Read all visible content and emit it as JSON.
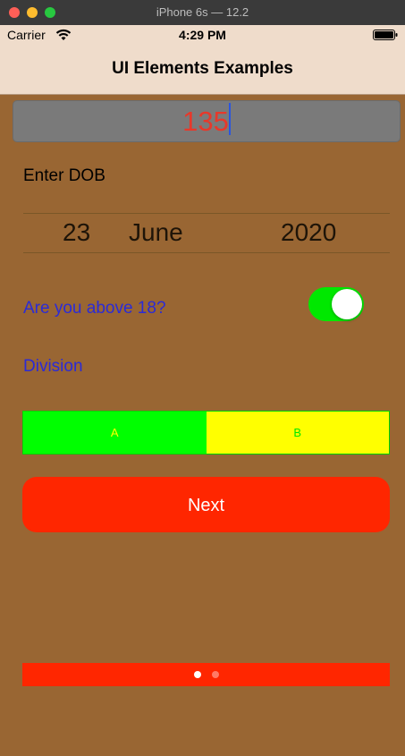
{
  "simulator": {
    "window_title": "iPhone 6s — 12.2"
  },
  "status_bar": {
    "carrier": "Carrier",
    "time": "4:29 PM",
    "wifi_icon": "wifi-icon",
    "battery_icon": "battery-icon"
  },
  "navigation": {
    "title": "UI Elements Examples"
  },
  "number_field": {
    "value": "135"
  },
  "dob": {
    "label": "Enter DOB",
    "day": "23",
    "month": "June",
    "year": "2020"
  },
  "age_toggle": {
    "label": "Are you above 18?",
    "is_on": true
  },
  "division": {
    "label": "Division",
    "segments": [
      "A",
      "B"
    ],
    "selected_index": 0
  },
  "next_button": {
    "label": "Next"
  },
  "page_control": {
    "page_count": 2,
    "current_page": 1
  },
  "colors": {
    "background": "#996633",
    "nav_background": "#efdccb",
    "number_text": "#e8382a",
    "label_blue": "#2b2bd6",
    "switch_on": "#00e800",
    "segment_a": "#00ff00",
    "segment_b": "#ffff00",
    "button_red": "#ff2600"
  }
}
